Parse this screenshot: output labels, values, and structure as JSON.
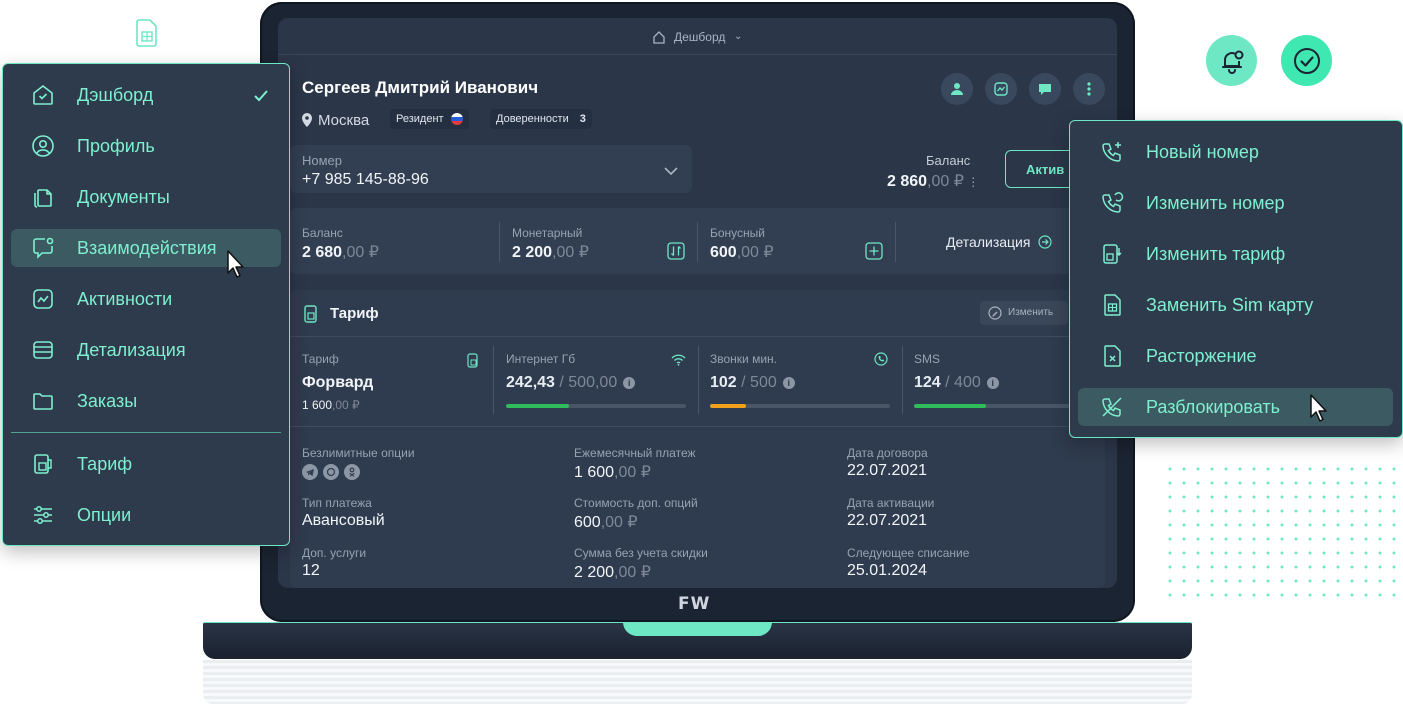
{
  "screen": {
    "topbar_label": "Дешборд",
    "customer_name": "Сергеев Дмитрий Иванович",
    "city": "Москва",
    "resident_label": "Резидент",
    "proxies_label": "Доверенности",
    "proxies_count": "3",
    "number_label": "Номер",
    "number_value": "+7 985 145-88-96",
    "balance_label": "Баланс",
    "balance_int": "2 860",
    "balance_dec": ",00 ₽",
    "activate_label": "Актив",
    "balances": [
      {
        "label": "Баланс",
        "int": "2 680",
        "dec": ",00 ₽"
      },
      {
        "label": "Монетарный",
        "int": "2 200",
        "dec": ",00 ₽"
      },
      {
        "label": "Бонусный",
        "int": "600",
        "dec": ",00 ₽"
      }
    ],
    "details_link": "Детализация",
    "tariff_title": "Тариф",
    "change_label": "Изменить",
    "tariff": {
      "label": "Тариф",
      "name": "Форвард",
      "price_int": "1 600",
      "price_dec": ",00 ₽"
    },
    "usage": [
      {
        "label": "Интернет Гб",
        "used": "242,43",
        "total": "/ 500,00",
        "fill": 0.35,
        "color": "#2ebd5a"
      },
      {
        "label": "Звонки мин.",
        "used": "102",
        "total": "/ 500",
        "fill": 0.2,
        "color": "#f2a21a"
      },
      {
        "label": "SMS",
        "used": "124",
        "total": "/ 400",
        "fill": 0.4,
        "color": "#2ebd5a"
      }
    ],
    "details_grid": [
      {
        "label": "Безлимитные опции",
        "value": ""
      },
      {
        "label": "Ежемесячный платеж",
        "int": "1 600",
        "dec": ",00 ₽"
      },
      {
        "label": "Дата договора",
        "value": "22.07.2021"
      },
      {
        "label": "Тип платежа",
        "value": "Авансовый"
      },
      {
        "label": "Стоимость доп. опций",
        "int": "600",
        "dec": ",00 ₽"
      },
      {
        "label": "Дата активации",
        "value": "22.07.2021"
      },
      {
        "label": "Доп. услуги",
        "value": "12"
      },
      {
        "label": "Сумма без учета скидки",
        "int": "2 200",
        "dec": ",00 ₽"
      },
      {
        "label": "Следующее списание",
        "value": "25.01.2024"
      }
    ],
    "logo": "FW"
  },
  "left_menu": {
    "items": [
      {
        "label": "Дэшборд",
        "icon": "dashboard-icon"
      },
      {
        "label": "Профиль",
        "icon": "profile-icon"
      },
      {
        "label": "Документы",
        "icon": "documents-icon"
      },
      {
        "label": "Взаимодействия",
        "icon": "interactions-icon"
      },
      {
        "label": "Активности",
        "icon": "activity-icon"
      },
      {
        "label": "Детализация",
        "icon": "details-icon"
      },
      {
        "label": "Заказы",
        "icon": "folder-icon"
      },
      {
        "label": "Тариф",
        "icon": "tariff-icon"
      },
      {
        "label": "Опции",
        "icon": "options-icon"
      }
    ],
    "checked": "Дэшборд",
    "active": "Взаимодействия"
  },
  "right_menu": {
    "items": [
      {
        "label": "Новый номер",
        "icon": "phone-plus-icon"
      },
      {
        "label": "Изменить номер",
        "icon": "phone-refresh-icon"
      },
      {
        "label": "Изменить тариф",
        "icon": "tariff-change-icon"
      },
      {
        "label": "Заменить Sim карту",
        "icon": "sim-card-icon"
      },
      {
        "label": "Расторжение",
        "icon": "document-x-icon"
      },
      {
        "label": "Разблокировать",
        "icon": "phone-unlock-icon"
      }
    ],
    "active": "Разблокировать"
  },
  "colors": {
    "accent": "#6ee7c5",
    "panel": "#2b3648",
    "green": "#2ebd5a",
    "orange": "#f2a21a"
  }
}
